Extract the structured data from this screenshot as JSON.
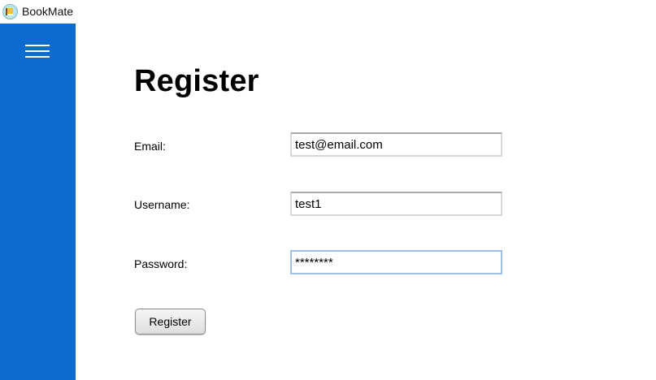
{
  "window": {
    "title": "BookMate",
    "icon": "bookmate-app-icon"
  },
  "sidebar": {
    "menu_icon": "hamburger-menu-icon",
    "color": "#0c6bcf"
  },
  "form": {
    "title": "Register",
    "email": {
      "label": "Email:",
      "value": "test@email.com"
    },
    "username": {
      "label": "Username:",
      "value": "test1"
    },
    "password": {
      "label": "Password:",
      "value": "********"
    },
    "submit_label": "Register"
  }
}
